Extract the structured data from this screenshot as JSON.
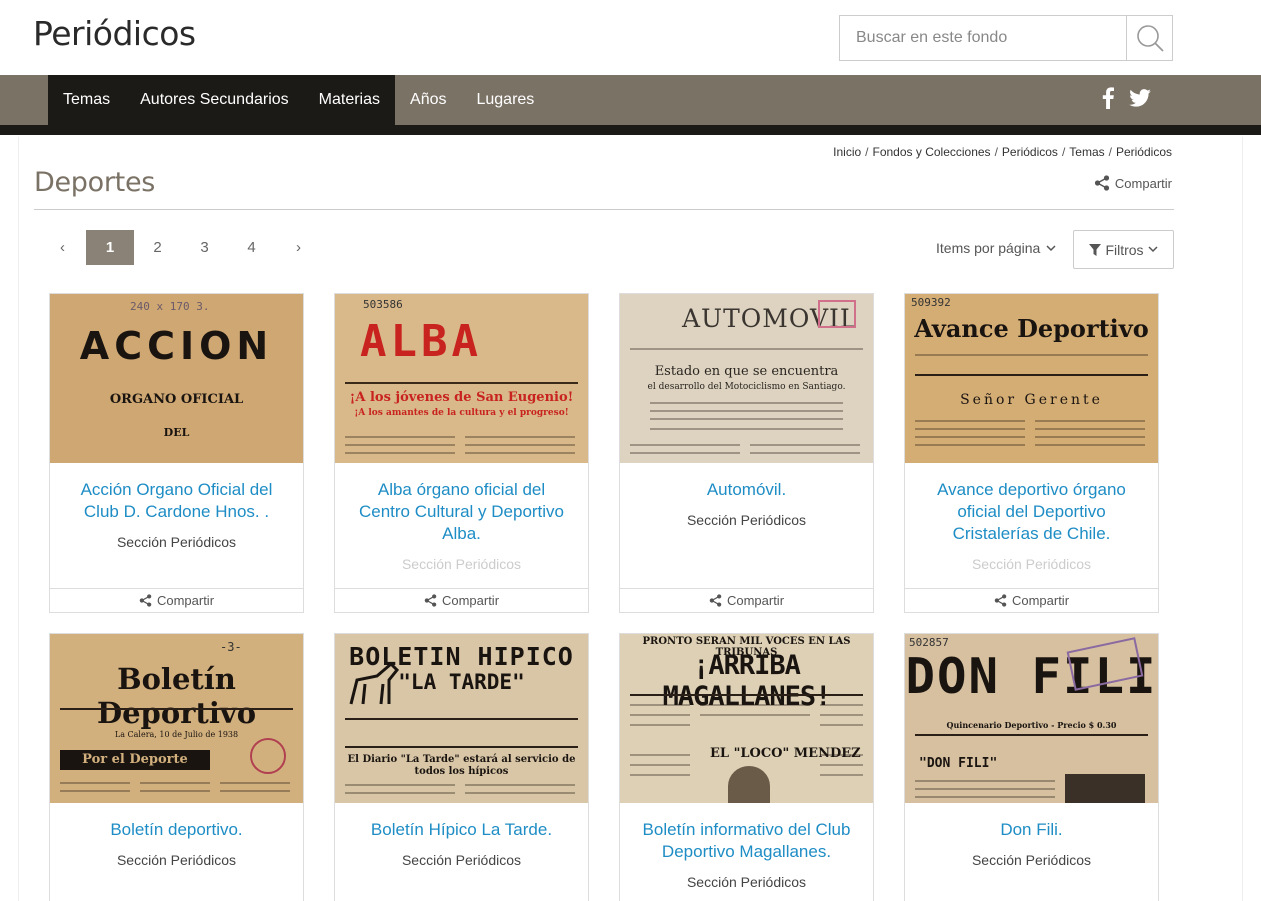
{
  "header": {
    "site_title": "Periódicos",
    "search_placeholder": "Buscar en este fondo"
  },
  "nav": {
    "items": [
      {
        "label": "Temas"
      },
      {
        "label": "Autores Secundarios"
      },
      {
        "label": "Materias"
      },
      {
        "label": "Años"
      },
      {
        "label": "Lugares"
      }
    ],
    "social": [
      "facebook-icon",
      "twitter-icon"
    ]
  },
  "breadcrumb": [
    "Inicio",
    "Fondos y Colecciones",
    "Periódicos",
    "Temas",
    "Periódicos"
  ],
  "page": {
    "title": "Deportes",
    "share_label": "Compartir"
  },
  "pagination": {
    "prev": "‹",
    "pages": [
      "1",
      "2",
      "3",
      "4"
    ],
    "current": "1",
    "next": "›"
  },
  "toolbar": {
    "items_per_page": "Items por página",
    "filters": "Filtros"
  },
  "cards": [
    {
      "title": "Acción Organo Oficial del Club D. Cardone Hnos. .",
      "section": "Sección Periódicos",
      "share": "Compartir",
      "thumb_text": "ACCION",
      "thumb_sub1": "ORGANO OFICIAL",
      "thumb_sub2": "DEL",
      "thumb_note": "240 x 170 3."
    },
    {
      "title": "Alba órgano oficial del Centro Cultural y Deportivo Alba.",
      "section": "Sección Periódicos",
      "share": "Compartir",
      "thumb_text": "ALBA",
      "thumb_sub1": "¡A los jóvenes de San Eugenio!",
      "thumb_sub2": "¡A los amantes de la cultura y el progreso!",
      "thumb_note": "503586"
    },
    {
      "title": "Automóvil.",
      "section": "Sección Periódicos",
      "share": "Compartir",
      "thumb_text": "AUTOMOVIL",
      "thumb_sub1": "Estado en que se encuentra",
      "thumb_sub2": "el desarrollo del Motociclismo en Santiago.",
      "thumb_note": ""
    },
    {
      "title": "Avance deportivo órgano oficial del Deportivo Cristalerías de Chile.",
      "section": "Sección Periódicos",
      "share": "Compartir",
      "thumb_text": "Avance Deportivo",
      "thumb_sub1": "Señor Gerente",
      "thumb_sub2": "",
      "thumb_note": "509392"
    },
    {
      "title": "Boletín deportivo.",
      "section": "Sección Periódicos",
      "share": "",
      "thumb_text": "Boletín Deportivo",
      "thumb_sub1": "Por el Deporte",
      "thumb_sub2": "La Calera, 10 de Julio de 1938",
      "thumb_note": "-3-"
    },
    {
      "title": "Boletín Hípico La Tarde.",
      "section": "Sección Periódicos",
      "share": "",
      "thumb_text": "BOLETIN HIPICO",
      "thumb_sub1": "\"LA TARDE\"",
      "thumb_sub2": "El Diario \"La Tarde\" estará al servicio de todos los hípicos",
      "thumb_note": ""
    },
    {
      "title": "Boletín informativo del Club Deportivo Magallanes.",
      "section": "Sección Periódicos",
      "share": "",
      "thumb_text": "¡ARRIBA MAGALLANES!",
      "thumb_sub1": "PRONTO SERAN MIL VOCES EN LAS TRIBUNAS",
      "thumb_sub2": "EL \"LOCO\" MENDEZ",
      "thumb_note": ""
    },
    {
      "title": "Don Fili.",
      "section": "Sección Periódicos",
      "share": "",
      "thumb_text": "DON FILI",
      "thumb_sub1": "\"DON FILI\"",
      "thumb_sub2": "Quincenario Deportivo - Precio $ 0.30",
      "thumb_note": "502857"
    }
  ]
}
